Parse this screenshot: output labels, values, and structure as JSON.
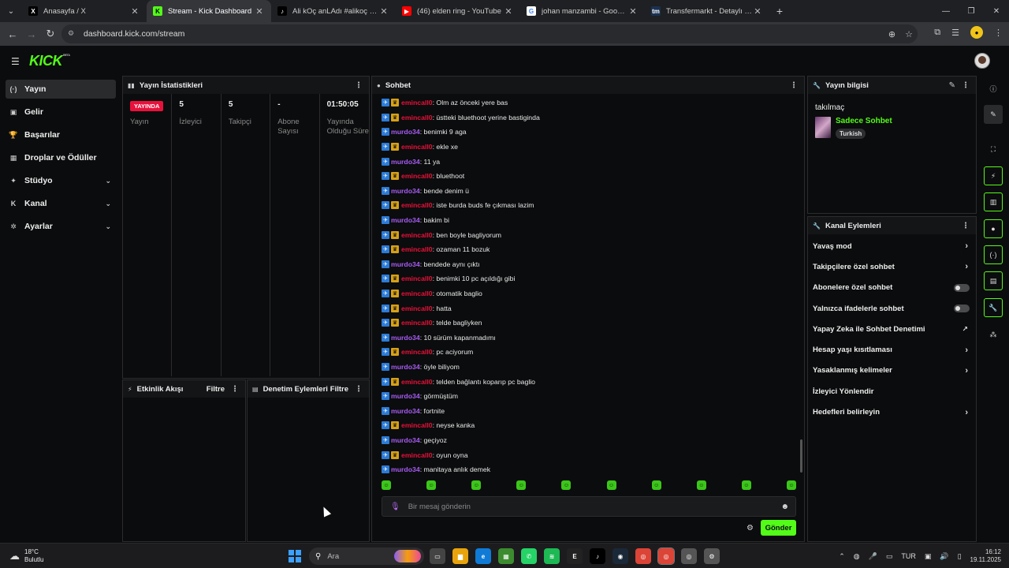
{
  "browser": {
    "tabs": [
      {
        "title": "Anasayfa / X",
        "icon": "x-logo-icon",
        "fav": "X",
        "fav_bg": "#000000",
        "fav_fg": "#ffffff"
      },
      {
        "title": "Stream - Kick Dashboard",
        "icon": "kick-logo-icon",
        "fav": "K",
        "fav_bg": "#53fc18",
        "fav_fg": "#000000"
      },
      {
        "title": "Ali kOç anLAdı #alikoç #alikoç",
        "icon": "tiktok-icon",
        "fav": "♪",
        "fav_bg": "#000000",
        "fav_fg": "#ffffff"
      },
      {
        "title": "(46) elden ring - YouTube",
        "icon": "youtube-icon",
        "fav": "▶",
        "fav_bg": "#ff0000",
        "fav_fg": "#ffffff"
      },
      {
        "title": "johan manzambi - Google'da Ar",
        "icon": "google-icon",
        "fav": "G",
        "fav_bg": "#ffffff",
        "fav_fg": "#4285f4"
      },
      {
        "title": "Transfermarkt - Detaylı oyuncu",
        "icon": "transfermarkt-icon",
        "fav": "tm",
        "fav_bg": "#1a3151",
        "fav_fg": "#ffffff"
      }
    ],
    "url": "dashboard.kick.com/stream",
    "new_tab": "+"
  },
  "sidebar": {
    "items": [
      {
        "label": "Yayın",
        "icon": "broadcast-icon",
        "glyph": "(·)",
        "active": true
      },
      {
        "label": "Gelir",
        "icon": "wallet-icon",
        "glyph": "▣"
      },
      {
        "label": "Başarılar",
        "icon": "trophy-icon",
        "glyph": "🏆"
      },
      {
        "label": "Droplar ve Ödüller",
        "icon": "gift-icon",
        "glyph": "▦"
      },
      {
        "label": "Stüdyo",
        "icon": "studio-icon",
        "glyph": "✦",
        "chevron": true
      },
      {
        "label": "Kanal",
        "icon": "channel-icon",
        "glyph": "K",
        "chevron": true
      },
      {
        "label": "Ayarlar",
        "icon": "gear-icon",
        "glyph": "✲",
        "chevron": true
      }
    ]
  },
  "stats": {
    "title": "Yayın İstatistikleri",
    "live_badge": "YAYINDA",
    "columns": [
      {
        "value": "",
        "label": "Yayın"
      },
      {
        "value": "5",
        "label": "İzleyici"
      },
      {
        "value": "5",
        "label": "Takipçi"
      },
      {
        "value": "-",
        "label": "Abone Sayısı"
      },
      {
        "value": "01:50:05",
        "label": "Yayında Olduğu Süre"
      }
    ]
  },
  "activity": {
    "title": "Etkinlik Akışı",
    "filter": "Filtre"
  },
  "moderation": {
    "title": "Denetim Eylemleri",
    "filter": "Filtre"
  },
  "chat": {
    "title": "Sohbet",
    "placeholder": "Bir mesaj gönderin",
    "send": "Gönder",
    "user_colors": {
      "emincall0": "#e8123a",
      "murdo34": "#a75cf5"
    },
    "messages": [
      {
        "user": "emincall0",
        "text": ": Olm az önceki yere bas"
      },
      {
        "user": "emincall0",
        "text": ": üstteki bluethoot yerine bastiginda"
      },
      {
        "user": "murdo34",
        "text": ": benimki 9 aga"
      },
      {
        "user": "emincall0",
        "text": ": ekle xe"
      },
      {
        "user": "murdo34",
        "text": ": 11 ya"
      },
      {
        "user": "emincall0",
        "text": ": bluethoot"
      },
      {
        "user": "murdo34",
        "text": ": bende denim ü"
      },
      {
        "user": "emincall0",
        "text": ": iste burda buds fe çıkması lazim"
      },
      {
        "user": "murdo34",
        "text": ": bakim bi"
      },
      {
        "user": "emincall0",
        "text": ": ben boyle bagliyorum"
      },
      {
        "user": "emincall0",
        "text": ": ozaman 11 bozuk"
      },
      {
        "user": "murdo34",
        "text": ": bendede aynı çıktı"
      },
      {
        "user": "emincall0",
        "text": ": benimki 10 pc açıldığı gibi"
      },
      {
        "user": "emincall0",
        "text": ": otomatik baglio"
      },
      {
        "user": "emincall0",
        "text": ": hatta"
      },
      {
        "user": "emincall0",
        "text": ": telde bagliyken"
      },
      {
        "user": "murdo34",
        "text": ": 10 sürüm kapanmadımı"
      },
      {
        "user": "emincall0",
        "text": ": pc aciyorum"
      },
      {
        "user": "murdo34",
        "text": ": öyle biliyom"
      },
      {
        "user": "emincall0",
        "text": ": telden bağlantı koparıp pc baglio"
      },
      {
        "user": "murdo34",
        "text": ": görmüştüm"
      },
      {
        "user": "murdo34",
        "text": ": fortnite"
      },
      {
        "user": "emincall0",
        "text": ": neyse kanka"
      },
      {
        "user": "murdo34",
        "text": ": geçiyoz"
      },
      {
        "user": "emincall0",
        "text": ": oyun oyna"
      },
      {
        "user": "murdo34",
        "text": ": manitaya anlık demek"
      }
    ],
    "emotes": [
      "kick-emote",
      "kick-emote",
      "kick-emote",
      "kick-emote",
      "kick-emote",
      "kick-emote",
      "kick-emote",
      "kick-emote",
      "kick-emote",
      "kick-emote"
    ]
  },
  "stream_info": {
    "title": "Yayın bilgisi",
    "stream_title": "takılmaç",
    "category": "Sadece Sohbet",
    "language_tag": "Turkish"
  },
  "channel_actions": {
    "title": "Kanal Eylemleri",
    "items": [
      {
        "label": "Yavaş mod",
        "type": "arrow"
      },
      {
        "label": "Takipçilere özel sohbet",
        "type": "arrow"
      },
      {
        "label": "Abonelere özel sohbet",
        "type": "toggle"
      },
      {
        "label": "Yalnızca ifadelerle sohbet",
        "type": "toggle"
      },
      {
        "label": "Yapay Zeka ile Sohbet Denetimi",
        "type": "external"
      },
      {
        "label": "Hesap yaşı kısıtlaması",
        "type": "arrow"
      },
      {
        "label": "Yasaklanmış kelimeler",
        "type": "arrow"
      },
      {
        "label": "İzleyici Yönlendir",
        "type": "none"
      },
      {
        "label": "Hedefleri belirleyin",
        "type": "arrow"
      }
    ]
  },
  "taskbar": {
    "weather_temp": "18°C",
    "weather_desc": "Bulutlu",
    "search_placeholder": "Ara",
    "language": "TUR",
    "time": "16:12",
    "date": "19.11.2025"
  }
}
